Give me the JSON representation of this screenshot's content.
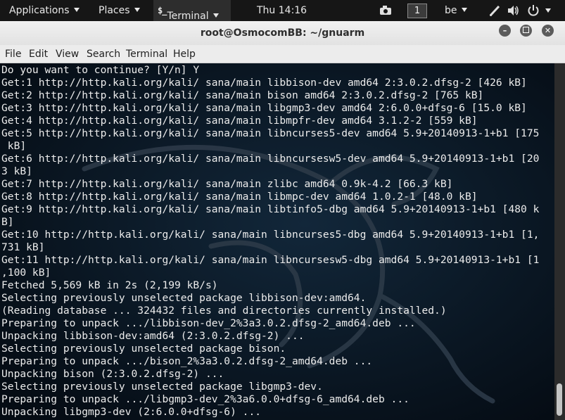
{
  "topbar": {
    "applications": "Applications",
    "places": "Places",
    "terminal_icon": "$_",
    "terminal": "Terminal",
    "clock": "Thu 14:16",
    "workspace": "1",
    "keyboard_layout": "be",
    "icons": [
      "camera-icon",
      "pen-icon",
      "volume-icon",
      "power-icon"
    ]
  },
  "window": {
    "title": "root@OsmocomBB: ~/gnuarm",
    "buttons": [
      "minimize-icon",
      "maximize-icon",
      "close-icon"
    ]
  },
  "menubar": {
    "file": "File",
    "edit": "Edit",
    "view": "View",
    "search": "Search",
    "terminal": "Terminal",
    "help": "Help"
  },
  "terminal": {
    "lines": [
      "Do you want to continue? [Y/n] Y",
      "Get:1 http://http.kali.org/kali/ sana/main libbison-dev amd64 2:3.0.2.dfsg-2 [426 kB]",
      "Get:2 http://http.kali.org/kali/ sana/main bison amd64 2:3.0.2.dfsg-2 [765 kB]",
      "Get:3 http://http.kali.org/kali/ sana/main libgmp3-dev amd64 2:6.0.0+dfsg-6 [15.0 kB]",
      "Get:4 http://http.kali.org/kali/ sana/main libmpfr-dev amd64 3.1.2-2 [559 kB]",
      "Get:5 http://http.kali.org/kali/ sana/main libncurses5-dev amd64 5.9+20140913-1+b1 [175",
      " kB]",
      "Get:6 http://http.kali.org/kali/ sana/main libncursesw5-dev amd64 5.9+20140913-1+b1 [20",
      "3 kB]",
      "Get:7 http://http.kali.org/kali/ sana/main zlibc amd64 0.9k-4.2 [66.3 kB]",
      "Get:8 http://http.kali.org/kali/ sana/main libmpc-dev amd64 1.0.2-1 [48.0 kB]",
      "Get:9 http://http.kali.org/kali/ sana/main libtinfo5-dbg amd64 5.9+20140913-1+b1 [480 k",
      "B]",
      "Get:10 http://http.kali.org/kali/ sana/main libncurses5-dbg amd64 5.9+20140913-1+b1 [1,",
      "731 kB]",
      "Get:11 http://http.kali.org/kali/ sana/main libncursesw5-dbg amd64 5.9+20140913-1+b1 [1",
      ",100 kB]",
      "Fetched 5,569 kB in 2s (2,199 kB/s)",
      "Selecting previously unselected package libbison-dev:amd64.",
      "(Reading database ... 324432 files and directories currently installed.)",
      "Preparing to unpack .../libbison-dev_2%3a3.0.2.dfsg-2_amd64.deb ...",
      "Unpacking libbison-dev:amd64 (2:3.0.2.dfsg-2) ...",
      "Selecting previously unselected package bison.",
      "Preparing to unpack .../bison_2%3a3.0.2.dfsg-2_amd64.deb ...",
      "Unpacking bison (2:3.0.2.dfsg-2) ...",
      "Selecting previously unselected package libgmp3-dev.",
      "Preparing to unpack .../libgmp3-dev_2%3a6.0.0+dfsg-6_amd64.deb ...",
      "Unpacking libgmp3-dev (2:6.0.0+dfsg-6) ..."
    ]
  },
  "colors": {
    "topbar_bg": "#161616",
    "terminal_bg": "#07111b",
    "terminal_text": "#ececec",
    "dragon_tint": "#2c3a48"
  }
}
